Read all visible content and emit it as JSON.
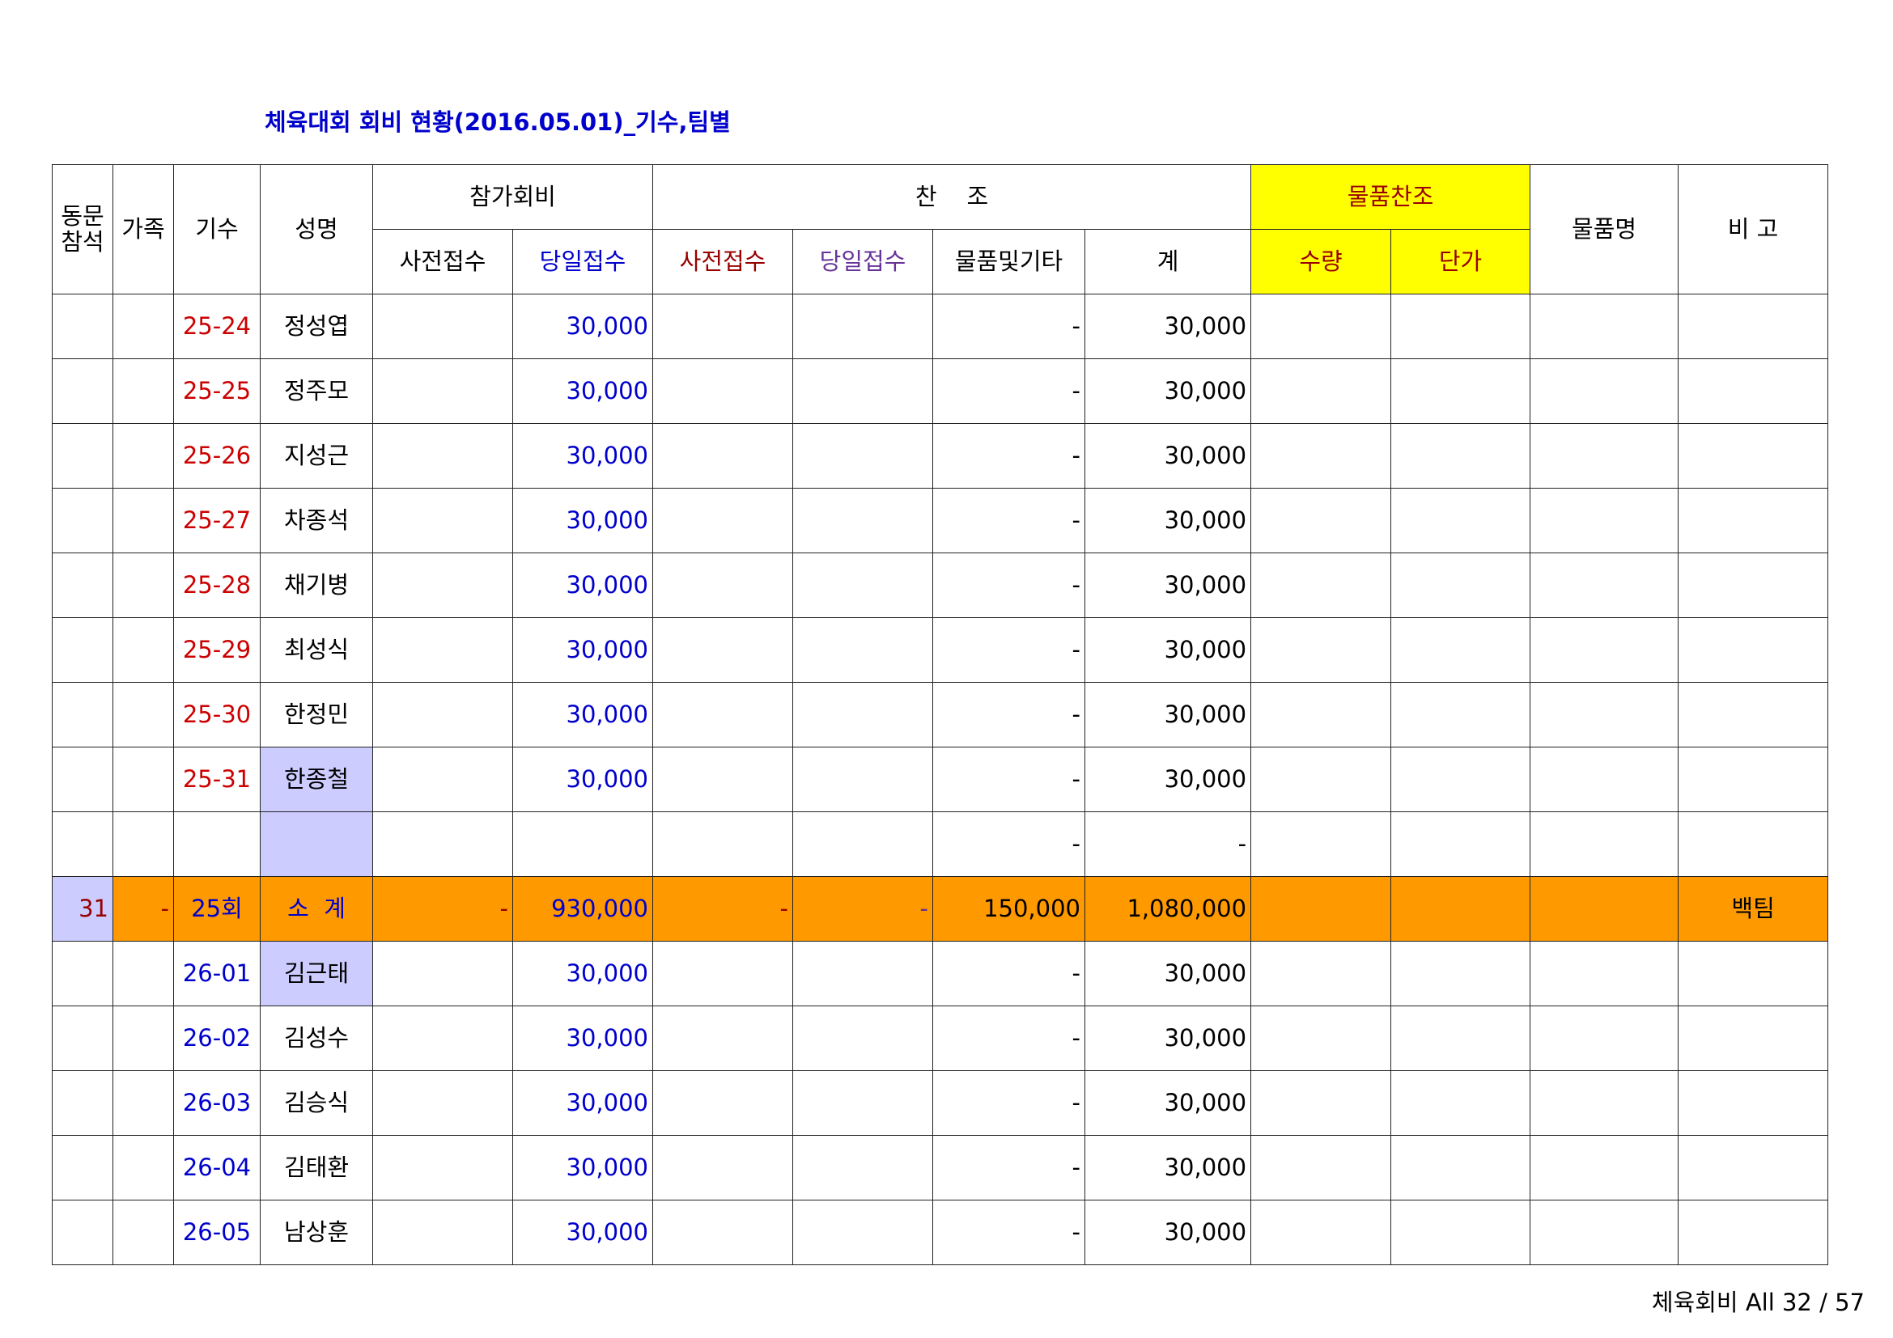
{
  "title": "체육대회 회비 현황(2016.05.01)_기수,팀별",
  "header": {
    "dongmun": "동문\n참석",
    "family": "가족",
    "gisu": "기수",
    "name": "성명",
    "fee_group": "참가회비",
    "fee_pre": "사전접수",
    "fee_day": "당일접수",
    "sponsor_group": "찬    조",
    "sp_pre": "사전접수",
    "sp_day": "당일접수",
    "sp_goods": "물품및기타",
    "sp_total": "계",
    "goods_group": "물품찬조",
    "qty": "수량",
    "price": "단가",
    "goods_name": "물품명",
    "note": "비 고"
  },
  "rows": [
    {
      "gisu": "25-24",
      "name": "정성엽",
      "fee_day": "30,000",
      "sp_goods": "-",
      "total": "30,000"
    },
    {
      "gisu": "25-25",
      "name": "정주모",
      "fee_day": "30,000",
      "sp_goods": "-",
      "total": "30,000"
    },
    {
      "gisu": "25-26",
      "name": "지성근",
      "fee_day": "30,000",
      "sp_goods": "-",
      "total": "30,000"
    },
    {
      "gisu": "25-27",
      "name": "차종석",
      "fee_day": "30,000",
      "sp_goods": "-",
      "total": "30,000"
    },
    {
      "gisu": "25-28",
      "name": "채기병",
      "fee_day": "30,000",
      "sp_goods": "-",
      "total": "30,000"
    },
    {
      "gisu": "25-29",
      "name": "최성식",
      "fee_day": "30,000",
      "sp_goods": "-",
      "total": "30,000"
    },
    {
      "gisu": "25-30",
      "name": "한정민",
      "fee_day": "30,000",
      "sp_goods": "-",
      "total": "30,000"
    },
    {
      "gisu": "25-31",
      "name": "한종철",
      "fee_day": "30,000",
      "sp_goods": "-",
      "total": "30,000"
    },
    {
      "gisu": "",
      "name": "",
      "fee_day": "",
      "sp_goods": "-",
      "total": "-"
    }
  ],
  "subtotal": {
    "count": "31",
    "family": "-",
    "gisu": "25회",
    "name": "소  계",
    "fee_pre": "-",
    "fee_day": "930,000",
    "sp_pre": "-",
    "sp_day": "-",
    "sp_goods": "150,000",
    "total": "1,080,000",
    "note": "백팀"
  },
  "rows2": [
    {
      "gisu": "26-01",
      "name": "김근태",
      "fee_day": "30,000",
      "sp_goods": "-",
      "total": "30,000"
    },
    {
      "gisu": "26-02",
      "name": "김성수",
      "fee_day": "30,000",
      "sp_goods": "-",
      "total": "30,000"
    },
    {
      "gisu": "26-03",
      "name": "김승식",
      "fee_day": "30,000",
      "sp_goods": "-",
      "total": "30,000"
    },
    {
      "gisu": "26-04",
      "name": "김태환",
      "fee_day": "30,000",
      "sp_goods": "-",
      "total": "30,000"
    },
    {
      "gisu": "26-05",
      "name": "남상훈",
      "fee_day": "30,000",
      "sp_goods": "-",
      "total": "30,000"
    }
  ],
  "footer": "체육회비 All 32 / 57",
  "colors": {
    "header_yellow": "#ffff00",
    "subtotal_orange": "#ff9900",
    "highlight_lavender": "#ccccff"
  }
}
